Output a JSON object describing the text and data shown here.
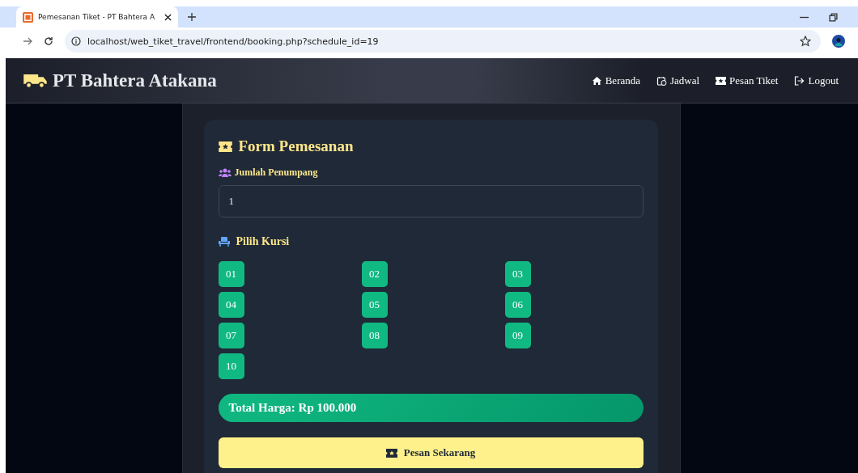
{
  "browser": {
    "tab_title": "Pemesanan Tiket - PT Bahtera A",
    "url": "localhost/web_tiket_travel/frontend/booking.php?schedule_id=19"
  },
  "navbar": {
    "brand": "PT Bahtera Atakana",
    "links": [
      {
        "label": "Beranda"
      },
      {
        "label": "Jadwal"
      },
      {
        "label": "Pesan Tiket"
      },
      {
        "label": "Logout"
      }
    ]
  },
  "form": {
    "title": "Form Pemesanan",
    "passenger_label": "Jumlah Penumpang",
    "passenger_value": "1",
    "seat_label": "Pilih Kursi",
    "seats": [
      {
        "label": "01",
        "selected": false
      },
      {
        "label": "02",
        "selected": false
      },
      {
        "label": "03",
        "selected": false
      },
      {
        "label": "04",
        "selected": false
      },
      {
        "label": "05",
        "selected": false
      },
      {
        "label": "06",
        "selected": false
      },
      {
        "label": "07",
        "selected": false
      },
      {
        "label": "08",
        "selected": false
      },
      {
        "label": "09",
        "selected": false
      },
      {
        "label": "10",
        "selected": false
      }
    ],
    "total": "Total Harga: Rp 100.000",
    "submit": "Pesan Sekarang"
  }
}
